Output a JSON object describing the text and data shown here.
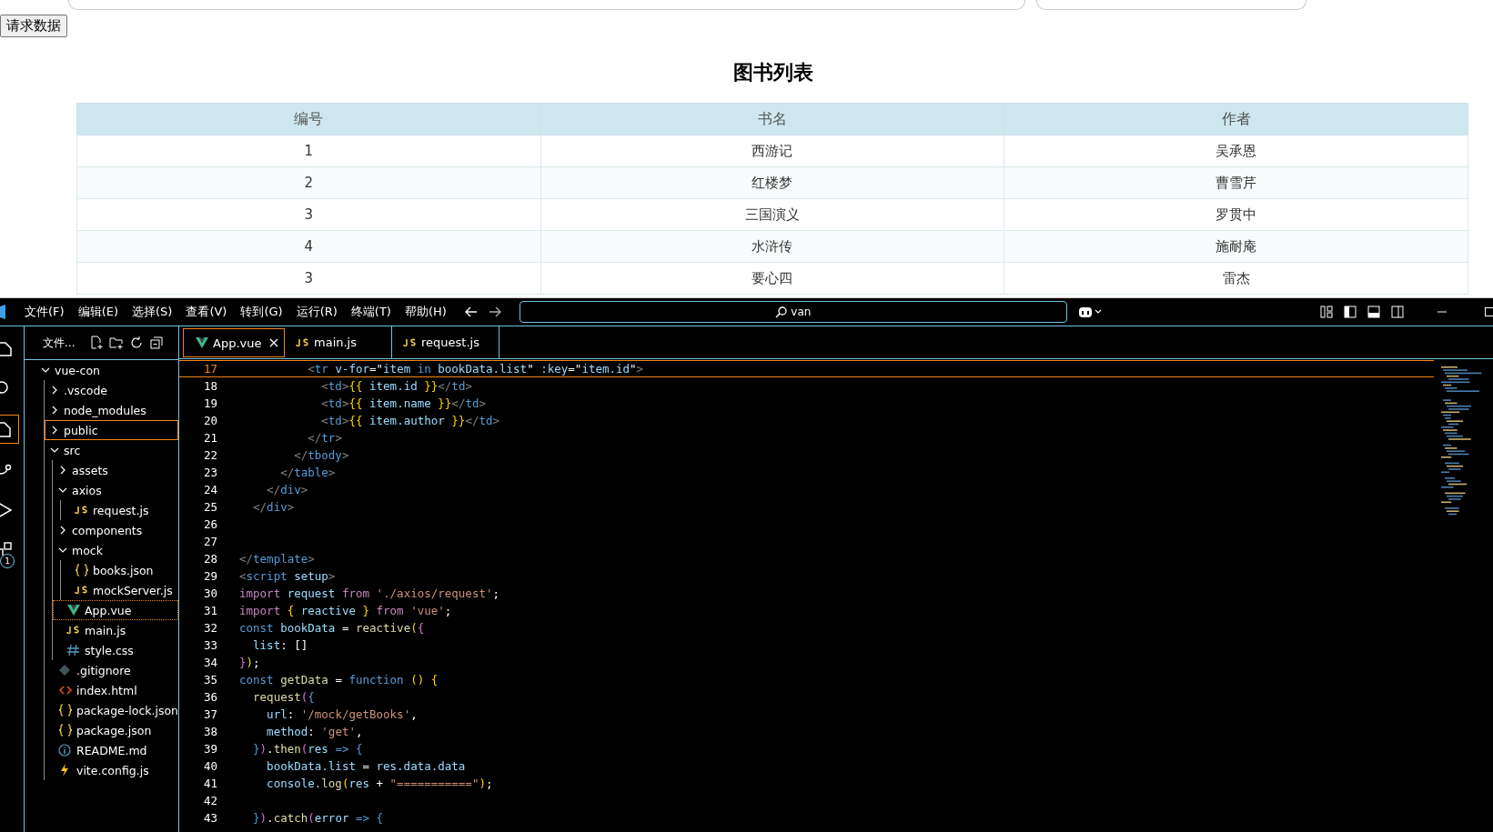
{
  "page": {
    "button": "请求数据",
    "heading": "图书列表",
    "table": {
      "columns": [
        "编号",
        "书名",
        "作者"
      ],
      "rows": [
        [
          "1",
          "西游记",
          "吴承恩"
        ],
        [
          "2",
          "红楼梦",
          "曹雪芹"
        ],
        [
          "3",
          "三国演义",
          "罗贯中"
        ],
        [
          "4",
          "水浒传",
          "施耐庵"
        ],
        [
          "3",
          "要心四",
          "雷杰"
        ]
      ]
    }
  },
  "editor": {
    "menu": [
      "文件(F)",
      "编辑(E)",
      "选择(S)",
      "查看(V)",
      "转到(G)",
      "运行(R)",
      "终端(T)",
      "帮助(H)"
    ],
    "search": {
      "value": "van"
    },
    "activity_badge": "1",
    "explorer": {
      "title": "文件...",
      "tree": [
        {
          "label": "vue-con",
          "kind": "folder",
          "expanded": true,
          "selected": false,
          "active": false,
          "children": [
            {
              "label": ".vscode",
              "kind": "folder",
              "expanded": false,
              "selected": false,
              "active": false
            },
            {
              "label": "node_modules",
              "kind": "folder",
              "expanded": false,
              "selected": false,
              "active": false
            },
            {
              "label": "public",
              "kind": "folder",
              "expanded": false,
              "selected": true,
              "active": false
            },
            {
              "label": "src",
              "kind": "folder",
              "expanded": true,
              "selected": false,
              "active": false,
              "children": [
                {
                  "label": "assets",
                  "kind": "folder",
                  "expanded": false,
                  "selected": false,
                  "active": false
                },
                {
                  "label": "axios",
                  "kind": "folder",
                  "expanded": true,
                  "selected": false,
                  "active": false,
                  "children": [
                    {
                      "label": "request.js",
                      "kind": "js",
                      "selected": false,
                      "active": false
                    }
                  ]
                },
                {
                  "label": "components",
                  "kind": "folder",
                  "expanded": false,
                  "selected": false,
                  "active": false
                },
                {
                  "label": "mock",
                  "kind": "folder",
                  "expanded": true,
                  "selected": false,
                  "active": false,
                  "children": [
                    {
                      "label": "books.json",
                      "kind": "json",
                      "selected": false,
                      "active": false
                    },
                    {
                      "label": "mockServer.js",
                      "kind": "js",
                      "selected": false,
                      "active": false
                    }
                  ]
                },
                {
                  "label": "App.vue",
                  "kind": "vue",
                  "selected": false,
                  "active": true
                },
                {
                  "label": "main.js",
                  "kind": "js",
                  "selected": false,
                  "active": false
                },
                {
                  "label": "style.css",
                  "kind": "css",
                  "selected": false,
                  "active": false
                }
              ]
            },
            {
              "label": ".gitignore",
              "kind": "git",
              "selected": false,
              "active": false
            },
            {
              "label": "index.html",
              "kind": "html",
              "selected": false,
              "active": false
            },
            {
              "label": "package-lock.json",
              "kind": "json",
              "selected": false,
              "active": false
            },
            {
              "label": "package.json",
              "kind": "json",
              "selected": false,
              "active": false
            },
            {
              "label": "README.md",
              "kind": "info",
              "selected": false,
              "active": false
            },
            {
              "label": "vite.config.js",
              "kind": "vite",
              "selected": false,
              "active": false
            }
          ]
        }
      ]
    },
    "tabs": [
      {
        "label": "App.vue",
        "kind": "vue",
        "selected": true
      },
      {
        "label": "main.js",
        "kind": "js",
        "selected": false
      },
      {
        "label": "request.js",
        "kind": "js",
        "selected": false
      }
    ],
    "code": [
      {
        "number": "17",
        "current": true,
        "tokens": [
          {
            "text": "          <",
            "kind": "bracket"
          },
          {
            "text": "tr",
            "kind": "tag"
          },
          {
            "text": " v-for",
            "kind": "attr"
          },
          {
            "text": "=\"",
            "kind": "text"
          },
          {
            "text": "item",
            "kind": "var"
          },
          {
            "text": " in ",
            "kind": "storage"
          },
          {
            "text": "bookData.list",
            "kind": "var"
          },
          {
            "text": "\"",
            "kind": "text"
          },
          {
            "text": " :key",
            "kind": "attr"
          },
          {
            "text": "=\"",
            "kind": "text"
          },
          {
            "text": "item.id",
            "kind": "var"
          },
          {
            "text": "\"",
            "kind": "text"
          },
          {
            "text": ">",
            "kind": "bracket"
          }
        ]
      },
      {
        "number": "18",
        "current": false,
        "tokens": [
          {
            "text": "            <",
            "kind": "bracket"
          },
          {
            "text": "td",
            "kind": "tag"
          },
          {
            "text": ">",
            "kind": "bracket"
          },
          {
            "text": "{{",
            "kind": "brace"
          },
          {
            "text": " item.id ",
            "kind": "var"
          },
          {
            "text": "}}",
            "kind": "brace"
          },
          {
            "text": "</",
            "kind": "bracket"
          },
          {
            "text": "td",
            "kind": "tag"
          },
          {
            "text": ">",
            "kind": "bracket"
          }
        ]
      },
      {
        "number": "19",
        "current": false,
        "tokens": [
          {
            "text": "            <",
            "kind": "bracket"
          },
          {
            "text": "td",
            "kind": "tag"
          },
          {
            "text": ">",
            "kind": "bracket"
          },
          {
            "text": "{{",
            "kind": "brace"
          },
          {
            "text": " item.name ",
            "kind": "var"
          },
          {
            "text": "}}",
            "kind": "brace"
          },
          {
            "text": "</",
            "kind": "bracket"
          },
          {
            "text": "td",
            "kind": "tag"
          },
          {
            "text": ">",
            "kind": "bracket"
          }
        ]
      },
      {
        "number": "20",
        "current": false,
        "tokens": [
          {
            "text": "            <",
            "kind": "bracket"
          },
          {
            "text": "td",
            "kind": "tag"
          },
          {
            "text": ">",
            "kind": "bracket"
          },
          {
            "text": "{{",
            "kind": "brace"
          },
          {
            "text": " item.author ",
            "kind": "var"
          },
          {
            "text": "}}",
            "kind": "brace"
          },
          {
            "text": "</",
            "kind": "bracket"
          },
          {
            "text": "td",
            "kind": "tag"
          },
          {
            "text": ">",
            "kind": "bracket"
          }
        ]
      },
      {
        "number": "21",
        "current": false,
        "tokens": [
          {
            "text": "          </",
            "kind": "bracket"
          },
          {
            "text": "tr",
            "kind": "tag"
          },
          {
            "text": ">",
            "kind": "bracket"
          }
        ]
      },
      {
        "number": "22",
        "current": false,
        "tokens": [
          {
            "text": "        </",
            "kind": "bracket"
          },
          {
            "text": "tbody",
            "kind": "tag"
          },
          {
            "text": ">",
            "kind": "bracket"
          }
        ]
      },
      {
        "number": "23",
        "current": false,
        "tokens": [
          {
            "text": "      </",
            "kind": "bracket"
          },
          {
            "text": "table",
            "kind": "tag"
          },
          {
            "text": ">",
            "kind": "bracket"
          }
        ]
      },
      {
        "number": "24",
        "current": false,
        "tokens": [
          {
            "text": "    </",
            "kind": "bracket"
          },
          {
            "text": "div",
            "kind": "tag"
          },
          {
            "text": ">",
            "kind": "bracket"
          }
        ]
      },
      {
        "number": "25",
        "current": false,
        "tokens": [
          {
            "text": "  </",
            "kind": "bracket"
          },
          {
            "text": "div",
            "kind": "tag"
          },
          {
            "text": ">",
            "kind": "bracket"
          }
        ]
      },
      {
        "number": "26",
        "current": false
      },
      {
        "number": "27",
        "current": false
      },
      {
        "number": "28",
        "current": false,
        "tokens": [
          {
            "text": "</",
            "kind": "bracket"
          },
          {
            "text": "template",
            "kind": "tag"
          },
          {
            "text": ">",
            "kind": "bracket"
          }
        ]
      },
      {
        "number": "29",
        "current": false,
        "tokens": [
          {
            "text": "<",
            "kind": "bracket"
          },
          {
            "text": "script",
            "kind": "tag"
          },
          {
            "text": " setup",
            "kind": "attr"
          },
          {
            "text": ">",
            "kind": "bracket"
          }
        ]
      },
      {
        "number": "30",
        "current": false,
        "tokens": [
          {
            "text": "import",
            "kind": "keyword"
          },
          {
            "text": " request ",
            "kind": "var"
          },
          {
            "text": "from",
            "kind": "keyword"
          },
          {
            "text": " './axios/request'",
            "kind": "string"
          },
          {
            "text": ";",
            "kind": "text"
          }
        ]
      },
      {
        "number": "31",
        "current": false,
        "tokens": [
          {
            "text": "import",
            "kind": "keyword"
          },
          {
            "text": " {",
            "kind": "brace"
          },
          {
            "text": " reactive ",
            "kind": "var"
          },
          {
            "text": "} ",
            "kind": "brace"
          },
          {
            "text": "from",
            "kind": "keyword"
          },
          {
            "text": " 'vue'",
            "kind": "string"
          },
          {
            "text": ";",
            "kind": "text"
          }
        ]
      },
      {
        "number": "32",
        "current": false,
        "tokens": [
          {
            "text": "const",
            "kind": "storage"
          },
          {
            "text": " bookData ",
            "kind": "var"
          },
          {
            "text": "= ",
            "kind": "text"
          },
          {
            "text": "reactive",
            "kind": "func"
          },
          {
            "text": "(",
            "kind": "brace"
          },
          {
            "text": "{",
            "kind": "brace2"
          }
        ]
      },
      {
        "number": "33",
        "current": false,
        "tokens": [
          {
            "text": "  list",
            "kind": "var"
          },
          {
            "text": ": []",
            "kind": "text"
          }
        ]
      },
      {
        "number": "34",
        "current": false,
        "tokens": [
          {
            "text": "}",
            "kind": "brace2"
          },
          {
            "text": ")",
            "kind": "brace"
          },
          {
            "text": ";",
            "kind": "text"
          }
        ]
      },
      {
        "number": "35",
        "current": false,
        "tokens": [
          {
            "text": "const",
            "kind": "storage"
          },
          {
            "text": " getData ",
            "kind": "func"
          },
          {
            "text": "= ",
            "kind": "text"
          },
          {
            "text": "function",
            "kind": "storage"
          },
          {
            "text": " ()",
            "kind": "brace"
          },
          {
            "text": " {",
            "kind": "brace"
          }
        ]
      },
      {
        "number": "36",
        "current": false,
        "tokens": [
          {
            "text": "  request",
            "kind": "func"
          },
          {
            "text": "(",
            "kind": "brace2"
          },
          {
            "text": "{",
            "kind": "storage"
          }
        ]
      },
      {
        "number": "37",
        "current": false,
        "tokens": [
          {
            "text": "    url",
            "kind": "var"
          },
          {
            "text": ": ",
            "kind": "text"
          },
          {
            "text": "'/mock/getBooks'",
            "kind": "string"
          },
          {
            "text": ",",
            "kind": "text"
          }
        ]
      },
      {
        "number": "38",
        "current": false,
        "tokens": [
          {
            "text": "    method",
            "kind": "var"
          },
          {
            "text": ": ",
            "kind": "text"
          },
          {
            "text": "'get'",
            "kind": "string"
          },
          {
            "text": ",",
            "kind": "text"
          }
        ]
      },
      {
        "number": "39",
        "current": false,
        "tokens": [
          {
            "text": "  }",
            "kind": "storage"
          },
          {
            "text": ")",
            "kind": "brace2"
          },
          {
            "text": ".",
            "kind": "text"
          },
          {
            "text": "then",
            "kind": "func"
          },
          {
            "text": "(",
            "kind": "brace2"
          },
          {
            "text": "res",
            "kind": "var"
          },
          {
            "text": " => ",
            "kind": "storage"
          },
          {
            "text": "{",
            "kind": "storage"
          }
        ]
      },
      {
        "number": "40",
        "current": false,
        "tokens": [
          {
            "text": "    bookData.list",
            "kind": "var"
          },
          {
            "text": " = ",
            "kind": "text"
          },
          {
            "text": "res.data.data",
            "kind": "var"
          }
        ]
      },
      {
        "number": "41",
        "current": false,
        "tokens": [
          {
            "text": "    console.",
            "kind": "var"
          },
          {
            "text": "log",
            "kind": "func"
          },
          {
            "text": "(",
            "kind": "brace"
          },
          {
            "text": "res",
            "kind": "var"
          },
          {
            "text": " + ",
            "kind": "text"
          },
          {
            "text": "\"===========\"",
            "kind": "string"
          },
          {
            "text": ")",
            "kind": "brace"
          },
          {
            "text": ";",
            "kind": "text"
          }
        ]
      },
      {
        "number": "42",
        "current": false
      },
      {
        "number": "43",
        "current": false,
        "tokens": [
          {
            "text": "  }",
            "kind": "storage"
          },
          {
            "text": ")",
            "kind": "brace2"
          },
          {
            "text": ".",
            "kind": "text"
          },
          {
            "text": "catch",
            "kind": "func"
          },
          {
            "text": "(",
            "kind": "brace2"
          },
          {
            "text": "error",
            "kind": "var"
          },
          {
            "text": " => ",
            "kind": "storage"
          },
          {
            "text": "{",
            "kind": "storage"
          }
        ]
      }
    ]
  }
}
